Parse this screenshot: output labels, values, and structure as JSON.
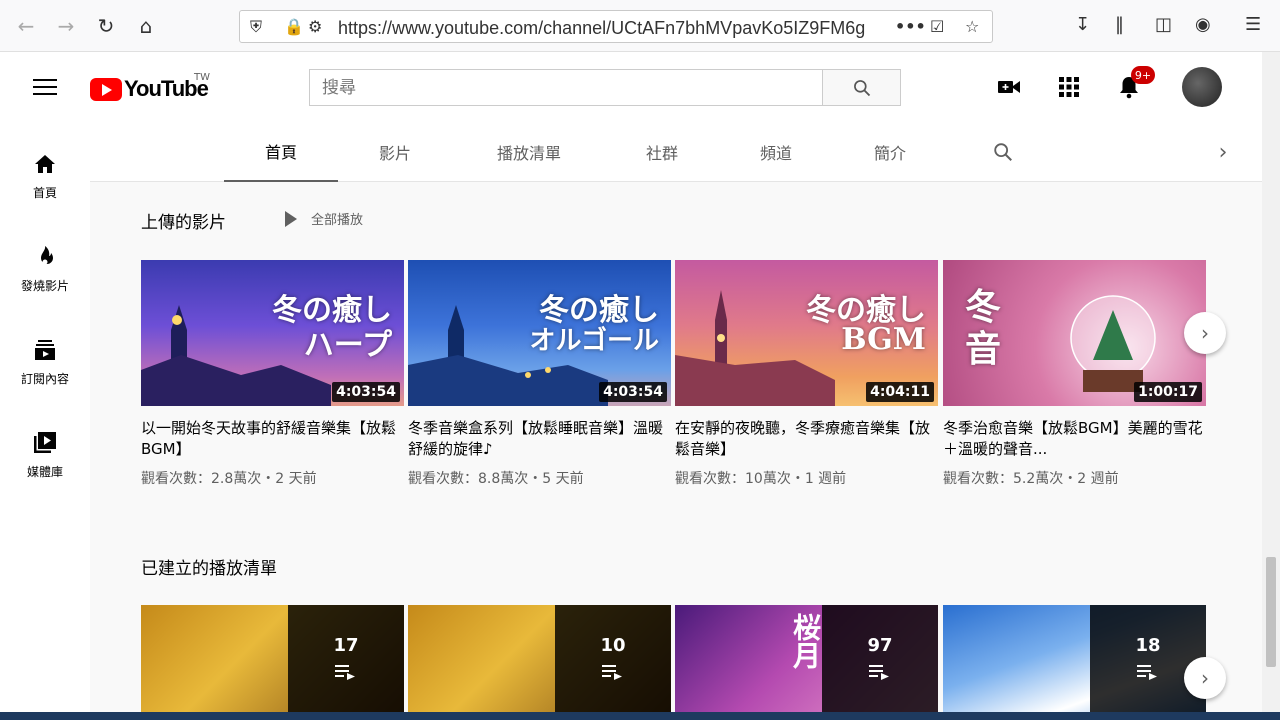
{
  "browser": {
    "url": "https://www.youtube.com/channel/UCtAFn7bhMVpavKo5IZ9FM6g",
    "more_label": "•••"
  },
  "header": {
    "logo_text": "YouTube",
    "logo_region": "TW",
    "search_placeholder": "搜尋",
    "notification_badge": "9+"
  },
  "guide": {
    "items": [
      {
        "label": "首頁",
        "icon": "home-icon"
      },
      {
        "label": "發燒影片",
        "icon": "fire-icon"
      },
      {
        "label": "訂閱內容",
        "icon": "subscriptions-icon"
      },
      {
        "label": "媒體庫",
        "icon": "library-icon"
      }
    ]
  },
  "tabs": {
    "items": [
      "首頁",
      "影片",
      "播放清單",
      "社群",
      "頻道",
      "簡介"
    ],
    "active": "首頁"
  },
  "uploads": {
    "title": "上傳的影片",
    "play_all": "全部播放",
    "videos": [
      {
        "title": "以一開始冬天故事的舒緩音樂集【放鬆BGM】",
        "views": "觀看次數：2.8萬次・2 天前",
        "duration": "4:03:54",
        "thumb_text_1": "冬の癒し",
        "thumb_text_2": "ハープ"
      },
      {
        "title": "冬季音樂盒系列【放鬆睡眠音樂】溫暖舒緩的旋律♪",
        "views": "觀看次數：8.8萬次・5 天前",
        "duration": "4:03:54",
        "thumb_text_1": "冬の癒し",
        "thumb_text_2": "オルゴール"
      },
      {
        "title": "在安靜的夜晚聽，冬季療癒音樂集【放鬆音樂】",
        "views": "觀看次數：10萬次・1 週前",
        "duration": "4:04:11",
        "thumb_text_1": "冬の癒し",
        "thumb_text_2": "BGM"
      },
      {
        "title": "冬季治愈音樂【放鬆BGM】美麗的雪花＋溫暖的聲音...",
        "views": "觀看次數：5.2萬次・2 週前",
        "duration": "1:00:17",
        "thumb_text_1": "冬",
        "thumb_text_2": "音"
      }
    ]
  },
  "playlists": {
    "title": "已建立的播放清單",
    "items": [
      {
        "count": "17"
      },
      {
        "count": "10"
      },
      {
        "count": "97",
        "thumb_text": "桜月"
      },
      {
        "count": "18"
      }
    ]
  }
}
